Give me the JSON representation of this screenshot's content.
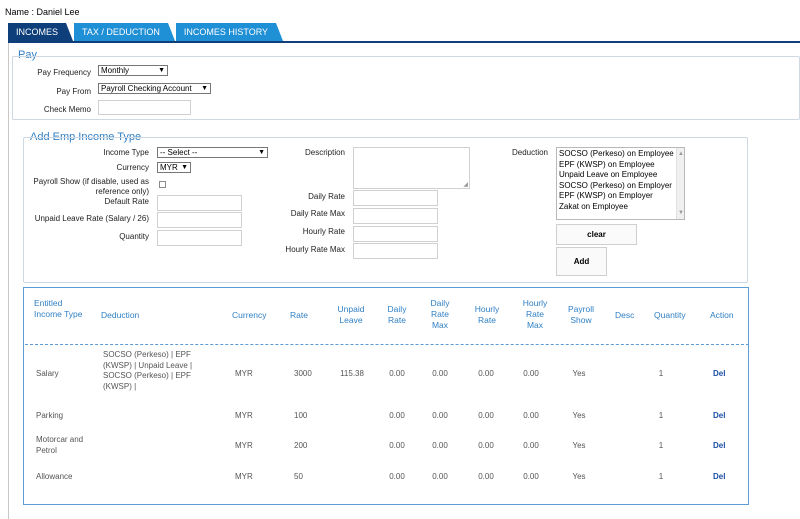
{
  "name_line": "Name : Daniel Lee",
  "tabs": [
    {
      "label": "INCOMES",
      "active": true
    },
    {
      "label": "TAX / DEDUCTION",
      "active": false
    },
    {
      "label": "INCOMES HISTORY",
      "active": false
    }
  ],
  "pay": {
    "title": "Pay",
    "frequency_label": "Pay Frequency",
    "frequency_value": "Monthly",
    "from_label": "Pay From",
    "from_value": "Payroll Checking Account",
    "memo_label": "Check Memo",
    "memo_value": ""
  },
  "add_income": {
    "title": "Add Emp Income Type",
    "income_type_label": "Income Type",
    "income_type_value": "-- Select --",
    "currency_label": "Currency",
    "currency_value": "MYR",
    "payroll_show_label": "Payroll Show (if disable, used as reference only)",
    "payroll_show_checked": false,
    "default_rate_label": "Default Rate",
    "unpaid_leave_label": "Unpaid Leave Rate (Salary / 26)",
    "quantity_label": "Quantity",
    "description_label": "Description",
    "daily_rate_label": "Daily Rate",
    "daily_rate_max_label": "Daily Rate Max",
    "hourly_rate_label": "Hourly Rate",
    "hourly_rate_max_label": "Hourly Rate Max",
    "deduction_label": "Deduction",
    "deduction_options": [
      "SOCSO (Perkeso) on Employee",
      "EPF (KWSP) on Employee",
      "Unpaid Leave on Employee",
      "SOCSO (Perkeso) on Employer",
      "EPF (KWSP) on Employer",
      "Zakat on Employee"
    ],
    "clear_label": "clear",
    "add_label": "Add"
  },
  "table": {
    "headers": {
      "income_type": "Entitled Income Type",
      "deduction": "Deduction",
      "currency": "Currency",
      "rate": "Rate",
      "unpaid_leave": "Unpaid Leave",
      "daily_rate": "Daily Rate",
      "daily_rate_max": "Daily Rate Max",
      "hourly_rate": "Hourly Rate",
      "hourly_rate_max": "Hourly Rate Max",
      "payroll_show": "Payroll Show",
      "desc": "Desc",
      "quantity": "Quantity",
      "action": "Action"
    },
    "rows": [
      {
        "income_type": "Salary",
        "deduction": "SOCSO (Perkeso) | EPF (KWSP) | Unpaid Leave | SOCSO (Perkeso) | EPF (KWSP) |",
        "currency": "MYR",
        "rate": "3000",
        "unpaid_leave": "115.38",
        "daily_rate": "0.00",
        "daily_rate_max": "0.00",
        "hourly_rate": "0.00",
        "hourly_rate_max": "0.00",
        "payroll_show": "Yes",
        "desc": "",
        "quantity": "1",
        "action": "Del"
      },
      {
        "income_type": "Parking",
        "deduction": "",
        "currency": "MYR",
        "rate": "100",
        "unpaid_leave": "",
        "daily_rate": "0.00",
        "daily_rate_max": "0.00",
        "hourly_rate": "0.00",
        "hourly_rate_max": "0.00",
        "payroll_show": "Yes",
        "desc": "",
        "quantity": "1",
        "action": "Del"
      },
      {
        "income_type": "Motorcar and Petrol",
        "deduction": "",
        "currency": "MYR",
        "rate": "200",
        "unpaid_leave": "",
        "daily_rate": "0.00",
        "daily_rate_max": "0.00",
        "hourly_rate": "0.00",
        "hourly_rate_max": "0.00",
        "payroll_show": "Yes",
        "desc": "",
        "quantity": "1",
        "action": "Del"
      },
      {
        "income_type": "Allowance",
        "deduction": "",
        "currency": "MYR",
        "rate": "50",
        "unpaid_leave": "",
        "daily_rate": "0.00",
        "daily_rate_max": "0.00",
        "hourly_rate": "0.00",
        "hourly_rate_max": "0.00",
        "payroll_show": "Yes",
        "desc": "",
        "quantity": "1",
        "action": "Del"
      }
    ]
  }
}
